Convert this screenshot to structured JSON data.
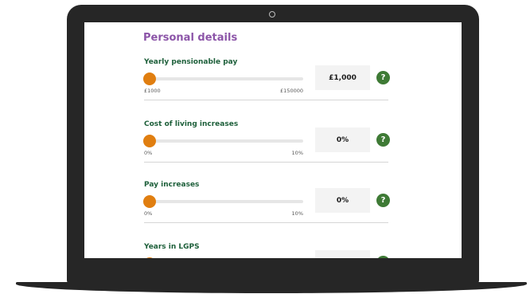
{
  "page": {
    "title": "Personal details"
  },
  "fields": [
    {
      "label": "Yearly pensionable pay",
      "min": "£1000",
      "max": "£150000",
      "value": "£1,000",
      "level": 0.0,
      "help": "?"
    },
    {
      "label": "Cost of living increases",
      "min": "0%",
      "max": "10%",
      "value": "0%",
      "level": 0.0,
      "help": "?"
    },
    {
      "label": "Pay increases",
      "min": "0%",
      "max": "10%",
      "value": "0%",
      "level": 0.0,
      "help": "?"
    },
    {
      "label": "Years in LGPS",
      "min": "",
      "max": "",
      "value": "",
      "level": 0.0,
      "help": "?"
    }
  ],
  "colors": {
    "title": "#8c55a8",
    "label": "#1d5f3a",
    "thumb": "#e07e10",
    "help": "#3e7a35",
    "frame": "#262626"
  },
  "icons": {
    "help": "question-mark-icon",
    "camera": "camera-icon"
  }
}
